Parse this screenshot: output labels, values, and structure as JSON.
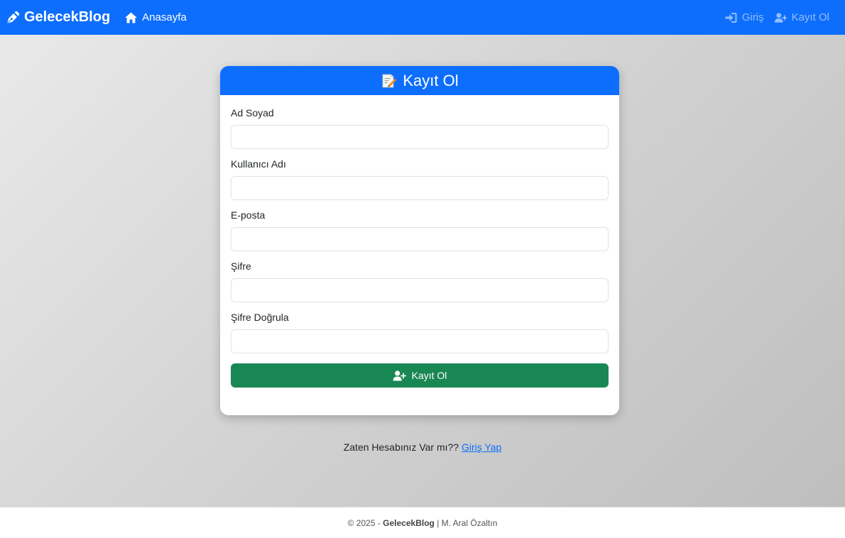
{
  "navbar": {
    "brand": "GelecekBlog",
    "home": "Anasayfa",
    "login": "Giriş",
    "register": "Kayıt Ol",
    "icons": {
      "brand": "pen-nib-icon",
      "home": "home-icon",
      "login": "sign-in-icon",
      "register": "user-plus-icon"
    }
  },
  "card": {
    "title": "Kayıt Ol",
    "title_icon": "memo-icon",
    "fields": [
      {
        "label": "Ad Soyad",
        "value": "",
        "placeholder": ""
      },
      {
        "label": "Kullanıcı Adı",
        "value": "",
        "placeholder": ""
      },
      {
        "label": "E-posta",
        "value": "",
        "placeholder": ""
      },
      {
        "label": "Şifre",
        "value": "",
        "placeholder": ""
      },
      {
        "label": "Şifre Doğrula",
        "value": "",
        "placeholder": ""
      }
    ],
    "submit_label": "Kayıt Ol",
    "submit_icon": "user-plus-icon"
  },
  "login_prompt": {
    "text": "Zaten Hesabınız Var mı??",
    "link": "Giriş Yap"
  },
  "footer": {
    "prefix": "© 2025 -",
    "brand": "GelecekBlog",
    "suffix": "| M. Aral Özaltın"
  },
  "colors": {
    "primary": "#0d6efd",
    "success": "#198754",
    "link": "#0d6efd"
  }
}
